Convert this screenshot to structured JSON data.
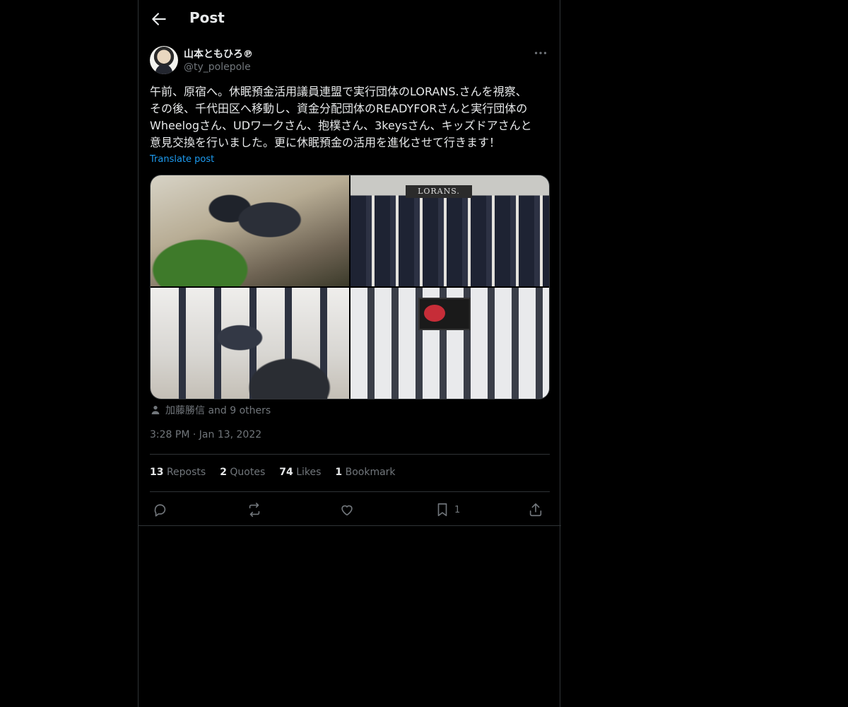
{
  "header": {
    "title": "Post"
  },
  "author": {
    "name": "山本ともひろ℗",
    "handle": "@ty_polepole"
  },
  "post": {
    "text": "午前、原宿へ。休眠預金活用議員連盟で実行団体のLORANS.さんを視察、\nその後、千代田区へ移動し、資金分配団体のREADYFORさんと実行団体の\nWheelogさん、UDワークさん、抱樸さん、3keysさん、キッズドアさんと\n意見交換を行いました。更に休眠預金の活用を進化させて行きます！",
    "translate_label": "Translate post",
    "photo_sign_text": "LORANS.",
    "liked_by": "加藤勝信 and 9 others",
    "time": "3:28 PM",
    "separator": "·",
    "date": "Jan 13, 2022"
  },
  "stats": {
    "reposts_count": "13",
    "reposts_label": "Reposts",
    "quotes_count": "2",
    "quotes_label": "Quotes",
    "likes_count": "74",
    "likes_label": "Likes",
    "bookmarks_count": "1",
    "bookmarks_label": "Bookmark"
  },
  "actions": {
    "bookmark_count": "1"
  },
  "icons": {
    "back": "arrow-left-icon",
    "more": "more-horizontal-icon",
    "person": "person-icon",
    "reply": "reply-icon",
    "repost": "repost-icon",
    "like": "heart-icon",
    "bookmark": "bookmark-icon",
    "share": "share-icon"
  },
  "colors": {
    "background": "#000000",
    "text": "#e7e9ea",
    "muted": "#71767b",
    "link": "#1d9bf0",
    "border": "#2f3336"
  }
}
